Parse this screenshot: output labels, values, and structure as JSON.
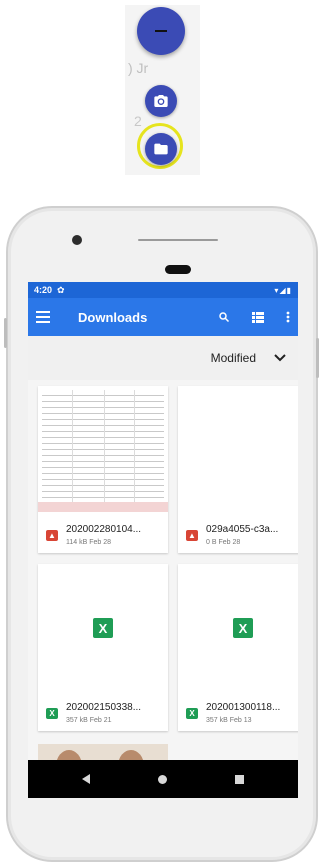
{
  "fab": {
    "main_icon": "minus-icon",
    "camera_icon": "camera-icon",
    "folder_icon": "folder-icon",
    "behind_text": ") Jr",
    "behind_text2": "2",
    "highlight_color": "#e6e41e"
  },
  "statusbar": {
    "time": "4:20",
    "settings_icon": "gear-icon",
    "system_icons": "wifi-signal-battery-icons"
  },
  "appbar": {
    "title": "Downloads",
    "menu_icon": "hamburger-menu-icon",
    "search_icon": "search-icon",
    "view_icon": "list-view-icon",
    "more_icon": "more-vert-icon",
    "color": "#2b77e8"
  },
  "sort": {
    "label": "Modified",
    "chevron_icon": "chevron-down-icon"
  },
  "files": [
    {
      "name": "202002280104...",
      "meta": "114 kB Feb 28",
      "type": "image",
      "thumbnail": "document-scan"
    },
    {
      "name": "029a4055-c3a...",
      "meta": "0 B Feb 28",
      "type": "image",
      "thumbnail": "blank"
    },
    {
      "name": "202002150338...",
      "meta": "357 kB Feb 21",
      "type": "excel",
      "thumbnail": "excel-icon"
    },
    {
      "name": "202001300118...",
      "meta": "357 kB Feb 13",
      "type": "excel",
      "thumbnail": "excel-icon"
    }
  ],
  "navbar": {
    "back_icon": "back-triangle-icon",
    "home_icon": "home-circle-icon",
    "recent_icon": "recents-square-icon"
  }
}
